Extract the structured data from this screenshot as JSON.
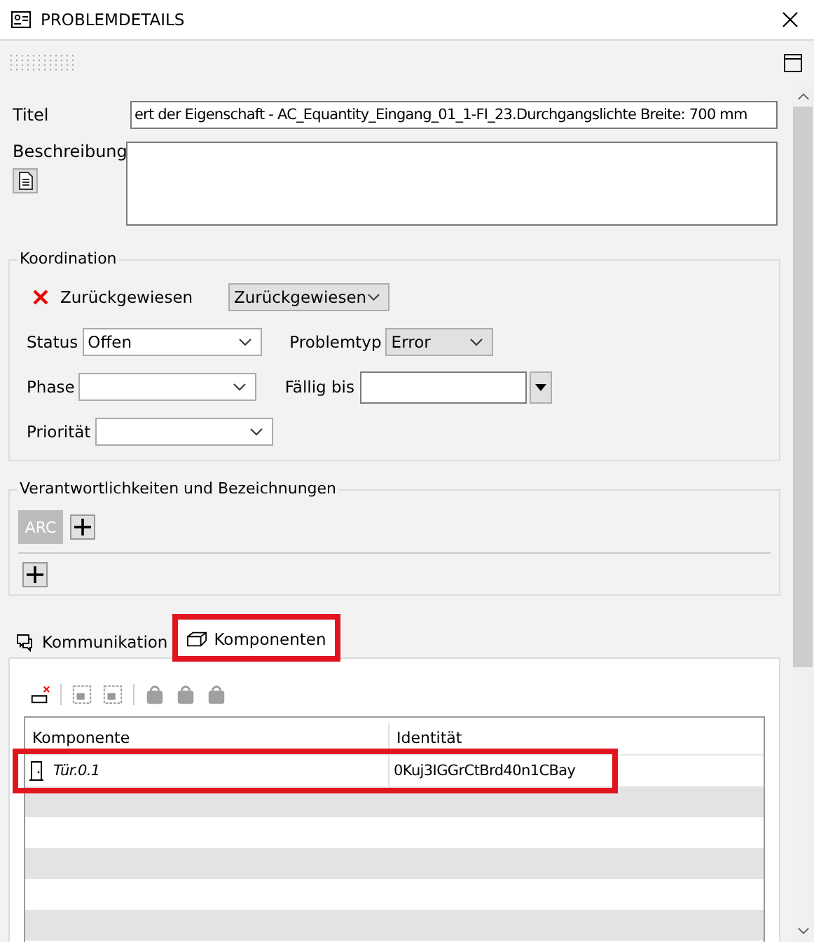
{
  "window": {
    "title": "PROBLEMDETAILS"
  },
  "fields": {
    "title": {
      "label": "Titel",
      "value": "ert der Eigenschaft - AC_Equantity_Eingang_01_1-FI_23.Durchgangslichte Breite: 700 mm"
    },
    "description": {
      "label": "Beschreibung"
    }
  },
  "coordination": {
    "title": "Koordination",
    "state_label": "Zurückgewiesen",
    "state_select": "Zurückgewiesen",
    "status": {
      "label": "Status",
      "value": "Offen"
    },
    "problem_type": {
      "label": "Problemtyp",
      "value": "Error"
    },
    "phase": {
      "label": "Phase"
    },
    "due": {
      "label": "Fällig bis"
    },
    "priority": {
      "label": "Priorität"
    }
  },
  "responsibilities": {
    "title": "Verantwortlichkeiten und Bezeichnungen",
    "tags": [
      "ARC"
    ]
  },
  "tabs": [
    {
      "label": "Kommunikation",
      "selected": false,
      "highlighted": false
    },
    {
      "label": "Komponenten",
      "selected": true,
      "highlighted": true
    }
  ],
  "table": {
    "columns": [
      "Komponente",
      "Identität"
    ],
    "rows": [
      {
        "cells": [
          "Tür.0.1",
          "0Kuj3IGGrCtBrd40n1CBay"
        ],
        "highlighted": true
      }
    ]
  }
}
